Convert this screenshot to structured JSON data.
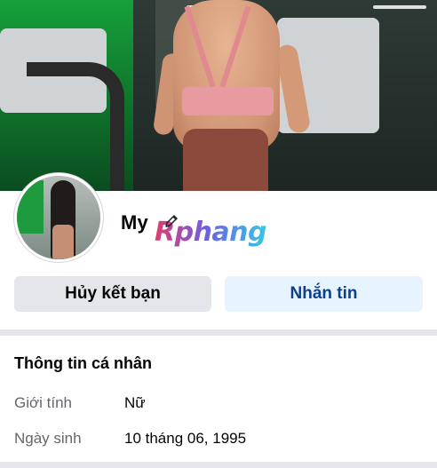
{
  "profile": {
    "name": "My",
    "watermark": "Rphang"
  },
  "actions": {
    "unfriend_label": "Hủy kết bạn",
    "message_label": "Nhắn tin"
  },
  "info": {
    "title": "Thông tin cá nhân",
    "rows": [
      {
        "label": "Giới tính",
        "value": "Nữ"
      },
      {
        "label": "Ngày sinh",
        "value": "10 tháng 06, 1995"
      }
    ]
  },
  "colors": {
    "message_button_bg": "#e7f3ff",
    "message_button_text": "#0d3f8d",
    "unfriend_button_bg": "#e4e6eb",
    "secondary_text": "#65676b"
  },
  "icons": {
    "edit": "pencil-icon"
  }
}
